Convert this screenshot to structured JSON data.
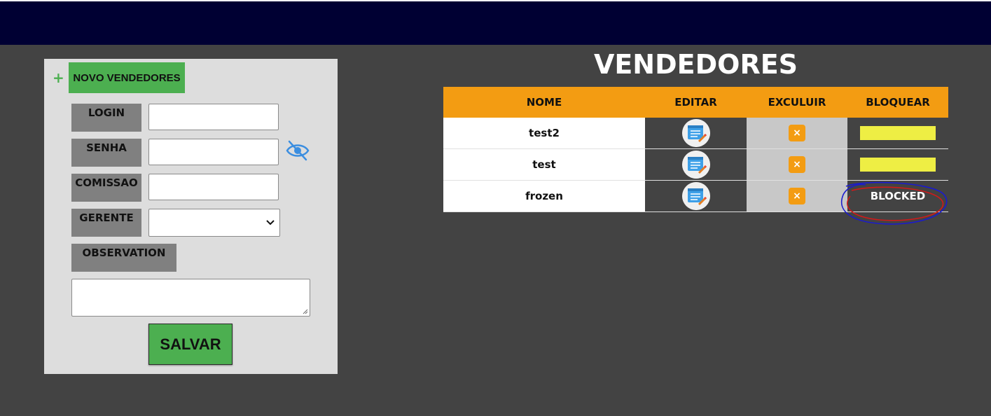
{
  "form": {
    "new_button": "NOVO VENDEDORES",
    "fields": {
      "login": "LOGIN",
      "senha": "SENHA",
      "comissao": "COMISSAO",
      "gerente": "GERENTE",
      "observation": "OBSERVATION"
    },
    "values": {
      "login": "",
      "senha": "",
      "comissao": "",
      "gerente": "",
      "observation": ""
    },
    "save_button": "SALVAR"
  },
  "table": {
    "title": "VENDEDORES",
    "headers": [
      "NOME",
      "EDITAR",
      "EXCULUIR",
      "BLOQUEAR"
    ],
    "rows": [
      {
        "name": "test2",
        "blocked": false,
        "block_label": ""
      },
      {
        "name": "test",
        "blocked": false,
        "block_label": ""
      },
      {
        "name": "frozen",
        "blocked": true,
        "block_label": "BLOCKED"
      }
    ],
    "delete_symbol": "×"
  },
  "colors": {
    "topbar": "#000033",
    "background": "#434343",
    "accent_green": "#4caf50",
    "header_orange": "#f39c12",
    "block_yellow": "#eeee44"
  },
  "icons": [
    "plus-icon",
    "eye-slash-icon",
    "chevron-down-icon",
    "edit-list-icon",
    "close-icon"
  ]
}
